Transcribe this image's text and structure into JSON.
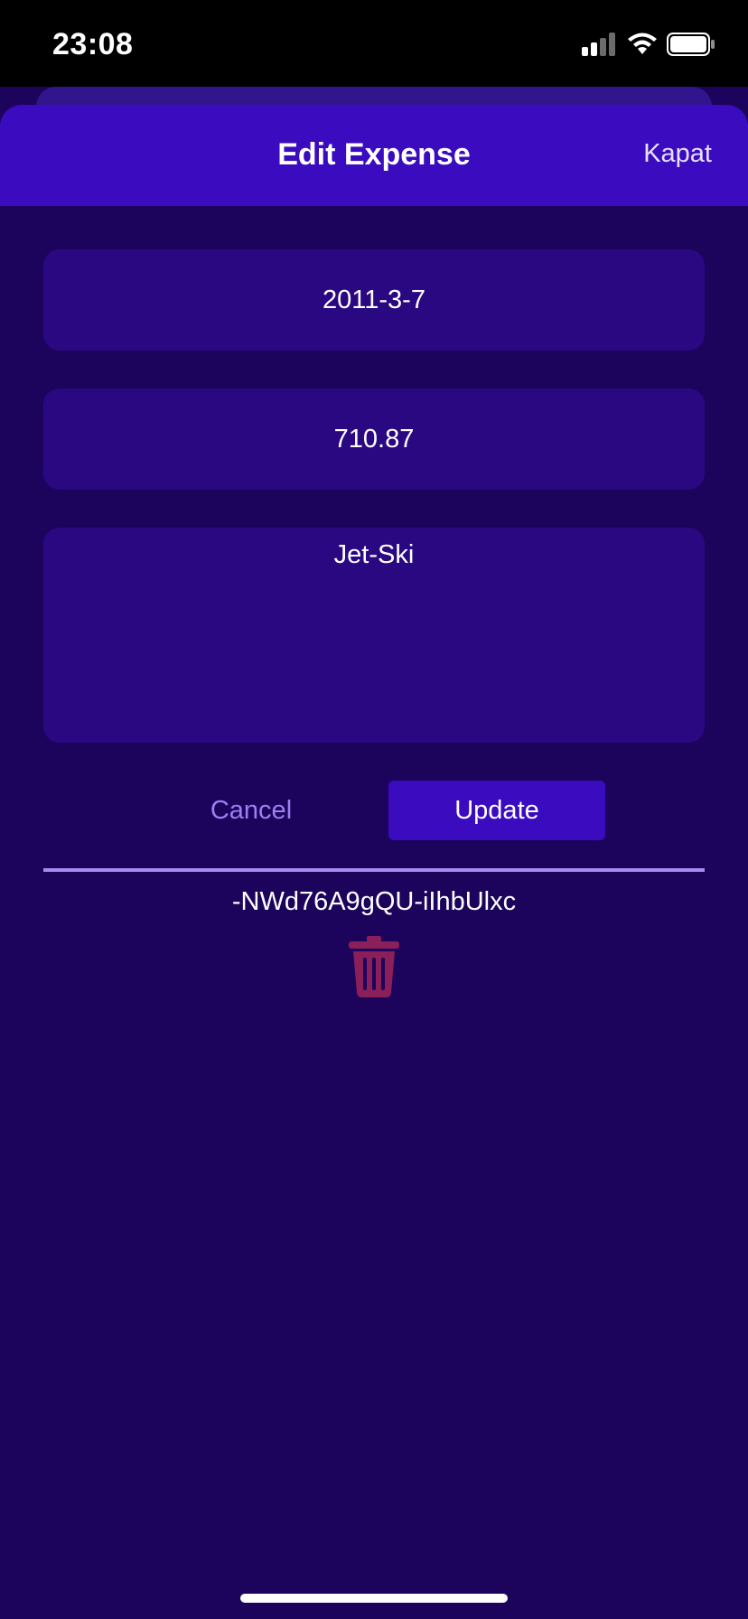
{
  "status_bar": {
    "time": "23:08",
    "icons": [
      "signal-icon",
      "wifi-icon",
      "battery-icon"
    ]
  },
  "header": {
    "title": "Edit Expense",
    "close_label": "Kapat"
  },
  "form": {
    "date_value": "2011-3-7",
    "amount_value": "710.87",
    "description_value": "Jet-Ski"
  },
  "actions": {
    "cancel_label": "Cancel",
    "update_label": "Update"
  },
  "record": {
    "id": "-NWd76A9gQU-iIhbUlxc",
    "delete_icon": "trash-icon"
  },
  "colors": {
    "background": "#1c045c",
    "header": "#3a0bbf",
    "field": "#2a0882",
    "accent": "#9c7ff0",
    "delete": "#8a1f5a"
  }
}
